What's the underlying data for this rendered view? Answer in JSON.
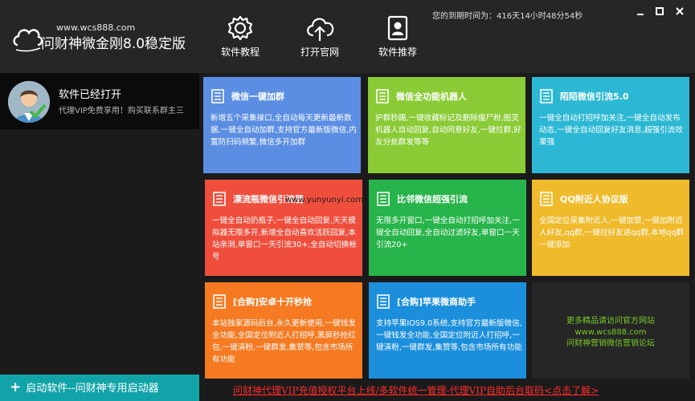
{
  "header": {
    "logo_url": "www.wcs888.com",
    "app_title": "问财神微金刚8.0稳定版",
    "expire_text": "您的到期时间为：416天14小时48分54秒",
    "buttons": [
      {
        "label": "软件教程",
        "icon": "gear-icon"
      },
      {
        "label": "打开官网",
        "icon": "cloud-upload-icon"
      },
      {
        "label": "软件推荐",
        "icon": "user-card-icon"
      }
    ]
  },
  "sidebar": {
    "user_name": "软件已经打开",
    "user_sub": "代理VIP免费享用！购买联系群主三",
    "launch_label": "启动软件--问财神专用启动器"
  },
  "tiles": [
    {
      "title": "微信一键加群",
      "body": "新增五个采集接口,全自动每天更新最新数据,一键全自动加群,支持官方最新版微信,内置防扫码频繁,微信多开加群"
    },
    {
      "title": "微信全功能机器人",
      "body": "护群秒踢,一键收藏标记及删除僵尸粉,图灵机器人自动回复,自动同意好友,一键拉群,好友分批群发等等"
    },
    {
      "title": "陌陌微信引流5.0",
      "body": "一键全自动打招呼加关注,一键全自动发布动态,一键全自动回复好友消息,超强引流效果强"
    },
    {
      "title": "漂流瓶微信引流器",
      "body": "一键全自动扔瓶子,一键全自动回复,天天模拟器无限多开,新增全自动喜欢活跃回复,本站亲测,单窗口一天引流30+,全自动切换帐号"
    },
    {
      "title": "比邻微信超强引流",
      "body": "无限多开窗口,一键全自动打招呼加关注,一键全自动回复,全自动过滤好友,单窗口一天引流20+"
    },
    {
      "title": "QQ附近人协议版",
      "body": "全国定位采集附近人,一键加赞,一键加附近人好友,qq群,一键拉好友进qq群,本地qq群一键添加"
    },
    {
      "title": "[合购]安卓十开秒抢",
      "body": "本站独家源码后台,永久更新使用,一键钱发全功能,全国定位附近人打招呼,黑屏秒抢红包,一键清粉,一键群发,集赞等,包含市场所有功能"
    },
    {
      "title": "[合购]苹果微商助手",
      "body": "支持苹果IOS9.0系统,支持官方最新版微信,一键钱发全功能,全国定位附近人打招呼,一键清粉,一键群发,集赞等,包含市场所有功能"
    }
  ],
  "promo": {
    "line1": "更多精品请访问官方网站",
    "line2": "www.wcs888.com",
    "line3": "问财神营销微信营销论坛"
  },
  "watermark": "www.yunyunyi.com",
  "bottom_link": "问财神代理VIP充值授权平台上线/多软件统一管理-代理VIP自助后台取码<点击了解>",
  "colors": {
    "tile_blue": "#5b8ee3",
    "tile_green": "#8acb36",
    "tile_cyan": "#2cb8d4",
    "tile_red": "#ef4e3c",
    "tile_green2": "#27b44a",
    "tile_yellow": "#efba2b",
    "tile_orange": "#f57a22",
    "tile_sky": "#1c8fdc",
    "launch_teal": "#12a3a8",
    "link_red": "#ff2a2a"
  }
}
